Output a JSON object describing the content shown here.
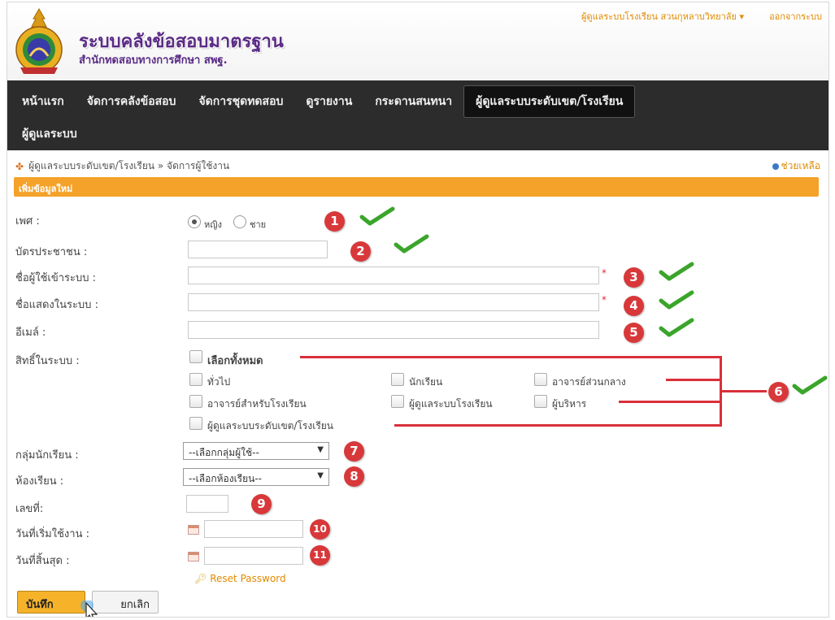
{
  "header": {
    "title": "ระบบคลังข้อสอบมาตรฐาน",
    "subtitle": "สำนักทดสอบทางการศึกษา สพฐ.",
    "user_menu": "ผู้ดูแลระบบโรงเรียน สวนกุหลาบวิทยาลัย ▾",
    "logout": "ออกจากระบบ"
  },
  "nav": {
    "items": [
      "หน้าแรก",
      "จัดการคลังข้อสอบ",
      "จัดการชุดทดสอบ",
      "ดูรายงาน",
      "กระดานสนทนา",
      "ผู้ดูแลระบบระดับเขต/โรงเรียน",
      "ผู้ดูแลระบบ"
    ],
    "active_index": 5
  },
  "breadcrumb": {
    "text": "ผู้ดูแลระบบระดับเขต/โรงเรียน » จัดการผู้ใช้งาน",
    "help": "ช่วยเหลือ"
  },
  "section_title": "เพิ่มข้อมูลใหม่",
  "form": {
    "gender_label": "เพศ :",
    "gender_options": [
      "หญิง",
      "ชาย"
    ],
    "gender_selected": "หญิง",
    "id_card_label": "บัตรประชาชน :",
    "username_label": "ชื่อผู้ใช้เข้าระบบ :",
    "display_name_label": "ชื่อแสดงในระบบ :",
    "email_label": "อีเมล์ :",
    "required_mark": "*",
    "rights_label": "สิทธิ์ในระบบ :",
    "rights": {
      "select_all": "เลือกทั้งหมด",
      "general": "ทั่วไป",
      "student": "นักเรียน",
      "central_teacher": "อาจารย์ส่วนกลาง",
      "school_teacher": "อาจารย์สำหรับโรงเรียน",
      "school_admin": "ผู้ดูแลระบบโรงเรียน",
      "executive": "ผู้บริหาร",
      "area_admin": "ผู้ดูแลระบบระดับเขต/โรงเรียน"
    },
    "student_group_label": "กลุ่มนักเรียน :",
    "student_group_value": "--เลือกกลุ่มผู้ใช้--",
    "classroom_label": "ห้องเรียน :",
    "classroom_value": "--เลือกห้องเรียน--",
    "number_label": "เลขที่:",
    "start_date_label": "วันที่เริ่มใช้งาน :",
    "end_date_label": "วันที่สิ้นสุด :",
    "reset_password": "Reset Password",
    "save_button": "บันทึก",
    "cancel_button": "ยกเลิก"
  },
  "annotations": [
    "1",
    "2",
    "3",
    "4",
    "5",
    "6",
    "7",
    "8",
    "9",
    "10",
    "11"
  ],
  "icons": [
    "logo-emblem",
    "breadcrumb-icon",
    "help-icon",
    "calendar-icon",
    "key-icon",
    "check-icon",
    "cursor-icon"
  ],
  "colors": {
    "nav_bg": "#2c2c2c",
    "accent_orange": "#f4a22a",
    "brand_purple": "#5a2a86",
    "badge_red": "#d8383a",
    "check_green": "#3aa52a",
    "link_orange": "#e08a00"
  }
}
